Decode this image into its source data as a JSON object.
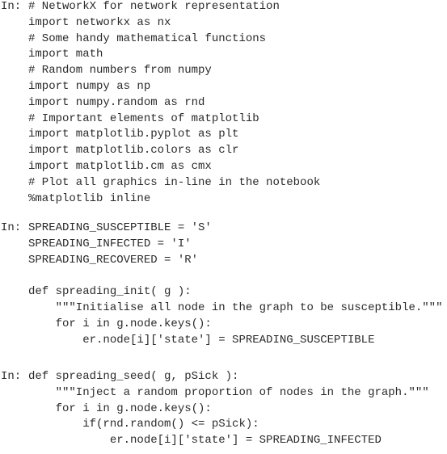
{
  "notebook": {
    "cells": [
      {
        "prompt": "In:",
        "lines": [
          "# NetworkX for network representation",
          "import networkx as nx",
          "# Some handy mathematical functions",
          "import math",
          "# Random numbers from numpy",
          "import numpy as np",
          "import numpy.random as rnd",
          "# Important elements of matplotlib",
          "import matplotlib.pyplot as plt",
          "import matplotlib.colors as clr",
          "import matplotlib.cm as cmx",
          "# Plot all graphics in-line in the notebook",
          "%matplotlib inline"
        ]
      },
      {
        "prompt": "In:",
        "lines": [
          "SPREADING_SUSCEPTIBLE = 'S'",
          "SPREADING_INFECTED = 'I'",
          "SPREADING_RECOVERED = 'R'",
          "",
          "def spreading_init( g ):",
          "    \"\"\"Initialise all node in the graph to be susceptible.\"\"\"",
          "    for i in g.node.keys():",
          "        er.node[i]['state'] = SPREADING_SUSCEPTIBLE"
        ]
      },
      {
        "prompt": "In:",
        "lines": [
          "def spreading_seed( g, pSick ):",
          "    \"\"\"Inject a random proportion of nodes in the graph.\"\"\"",
          "    for i in g.node.keys():",
          "        if(rnd.random() <= pSick):",
          "            er.node[i]['state'] = SPREADING_INFECTED"
        ]
      }
    ]
  }
}
